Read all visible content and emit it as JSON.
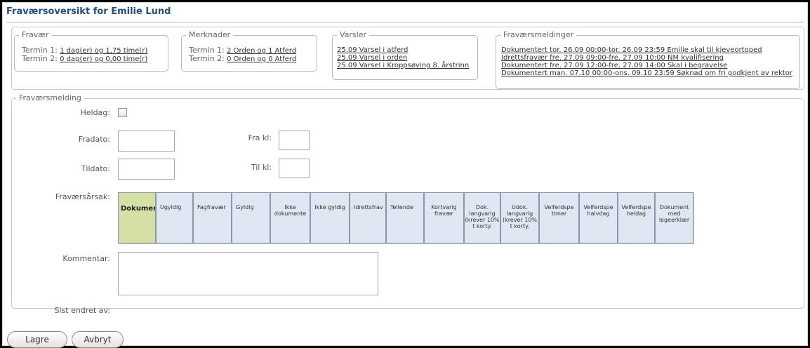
{
  "title": "Fraværsoversikt for Emilie Lund",
  "fravaer": {
    "legend": "Fravær",
    "rows": [
      {
        "label": "Termin 1:",
        "value": "1 dag(er) og 1,75 time(r)"
      },
      {
        "label": "Termin 2:",
        "value": "0 dag(er) og 0,00 time(r)"
      }
    ]
  },
  "merknader": {
    "legend": "Merknader",
    "rows": [
      {
        "label": "Termin 1:",
        "value": "2 Orden og 1 Atferd"
      },
      {
        "label": "Termin 2:",
        "value": "0 Orden og 0 Atferd"
      }
    ]
  },
  "varsler": {
    "legend": "Varsler",
    "items": [
      "25.09 Varsel i atferd",
      "25.09 Varsel i orden",
      "25.09 Varsel i Kroppsøving 8. årstrinn"
    ]
  },
  "fravaersmeldinger": {
    "legend": "Fraværsmeldinger",
    "items": [
      "Dokumentert tor. 26.09 00:00-tor. 26.09 23:59 Emilie skal til kjeveortoped",
      "Idrettsfravær fre. 27.09 09:00-fre. 27.09 10:00 NM kvalifisering",
      "Dokumentert fre. 27.09 12:00-fre. 27.09 14:00 Skal i begravelse",
      "Dokumentert man. 07.10 00:00-ons. 09.10 23:59 Søknad om fri godkjent av rektor"
    ]
  },
  "form": {
    "legend": "Fraværsmelding",
    "heldag_label": "Heldag:",
    "fradato_label": "Fradato:",
    "frakl_label": "Fra kl:",
    "tildato_label": "Tildato:",
    "tilkl_label": "Til kl:",
    "aarsak_label": "Fraværsårsak:",
    "kommentar_label": "Kommentar:",
    "sist_endret_label": "Sist endret av:",
    "reasons": [
      "Dokumer",
      "Ugyldig",
      "Fagfravær",
      "Gyldig",
      "Ikke dokumente",
      "Ikke gyldig",
      "Idrettsfrav",
      "Tellende",
      "Kortvarig fravær",
      "Dok. langvarig (krever 10% t korty.",
      "Udok. langvarig (krever 10% t korty.",
      "Velferdspe timer",
      "Velferdspe halvdag",
      "Velferdspe heldag",
      "Dokument med legeerklær"
    ]
  },
  "buttons": {
    "lagre": "Lagre",
    "avbryt": "Avbryt"
  },
  "colors": {
    "title": "#1f4f8a",
    "active_reason": "#d5e0a6",
    "reason_bg": "#dfe7f2"
  }
}
